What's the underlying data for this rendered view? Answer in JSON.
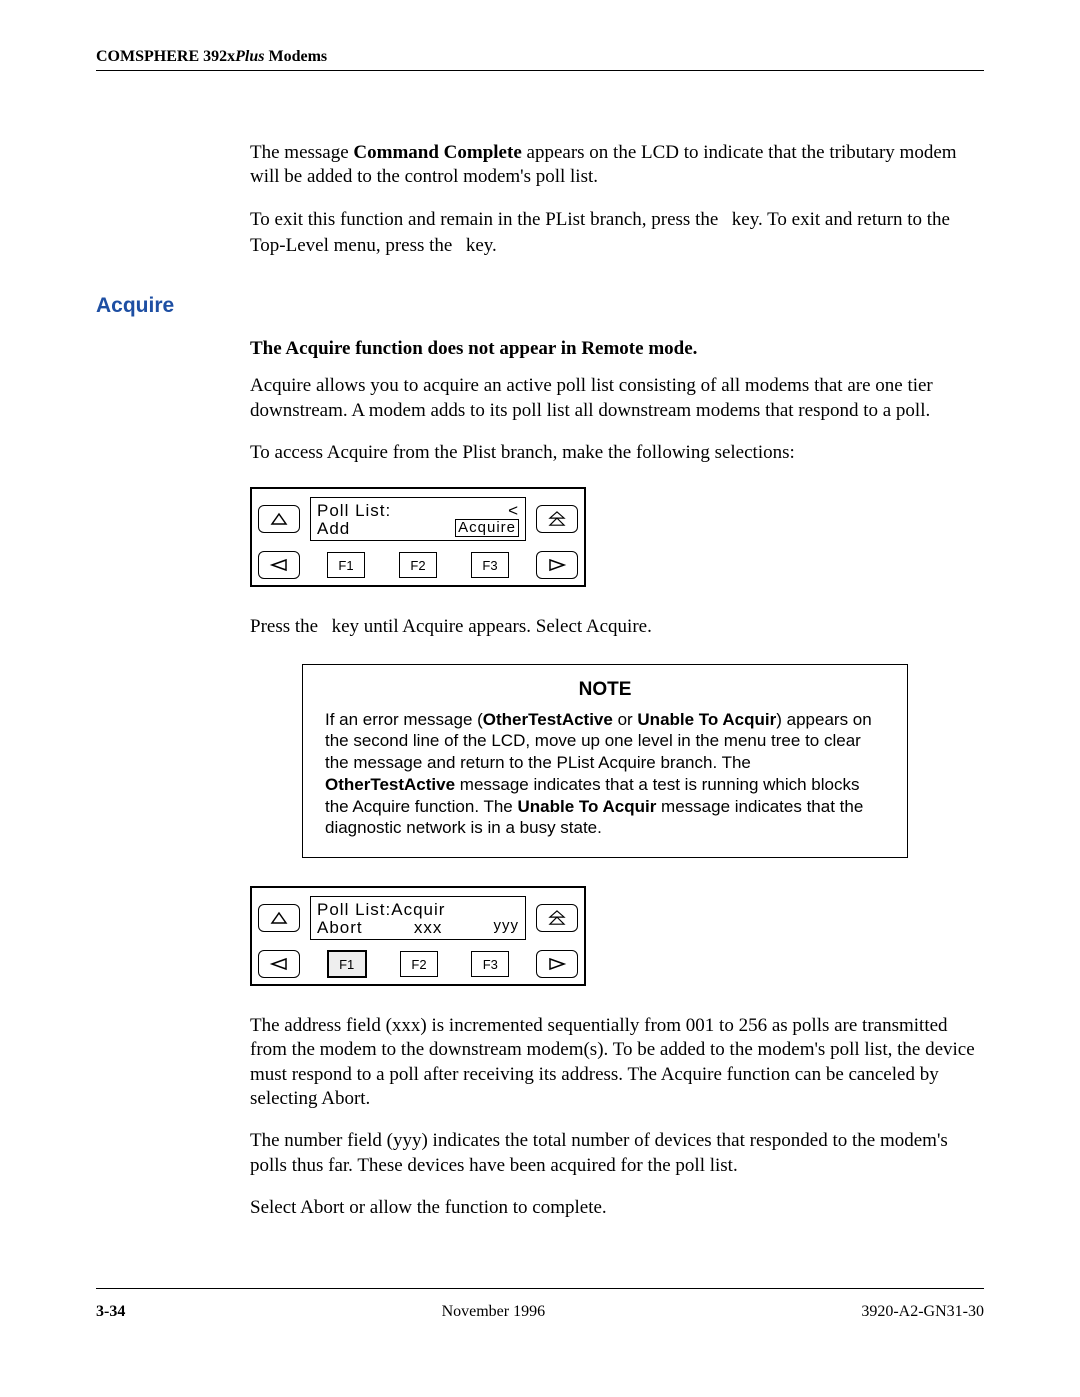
{
  "header": {
    "prefix": "COMSPHERE 392x",
    "italic": "Plus",
    "suffix": " Modems"
  },
  "paragraphs": {
    "p1_a": "The message ",
    "p1_bold": "Command Complete",
    "p1_b": " appears on the LCD to indicate that the tributary modem will be added to the control modem's poll list.",
    "p2_a": "To exit this function and remain in the PList branch, press the ",
    "p2_b": " key. To exit and return to the Top-Level menu, press the ",
    "p2_c": " key."
  },
  "section": {
    "heading": "Acquire",
    "statement": "The Acquire function does not appear in Remote mode.",
    "p1": "Acquire allows you to acquire an active poll list consisting of all modems that are one tier downstream. A modem adds to its poll list all downstream modems that respond to a poll.",
    "p2": "To access Acquire from the Plist branch, make the following selections:"
  },
  "lcd1": {
    "line1_left": "Poll  List:",
    "line1_right": "<",
    "line2_left": "Add",
    "line2_right_boxed": "Acquire",
    "f1": "F1",
    "f2": "F2",
    "f3": "F3"
  },
  "after_lcd1": {
    "a": "Press the ",
    "b": " key until Acquire appears. Select Acquire."
  },
  "note": {
    "title": "NOTE",
    "t1": "If an error message (",
    "b1": "OtherTestActive",
    "t2": " or ",
    "b2": "Unable To Acquir",
    "t3": ") appears on the second line of the LCD, move up one level in the menu tree to clear the message and return to the PList Acquire branch. The ",
    "b3": "OtherTestActive",
    "t4": " message indicates that a test is running which blocks the Acquire function. The ",
    "b4": "Unable To Acquir",
    "t5": " message indicates that the diagnostic network is in a busy state."
  },
  "lcd2": {
    "line1_left": "Poll  List:Acquir",
    "line2_left": "Abort",
    "line2_mid": "xxx",
    "line2_right": "yyy",
    "f1": "F1",
    "f2": "F2",
    "f3": "F3"
  },
  "tail": {
    "p1": "The address field (xxx) is incremented sequentially from 001 to 256 as polls are transmitted from the modem to the downstream modem(s). To be added to the modem's poll list, the device must respond to a poll after receiving its address. The Acquire function can be canceled by selecting Abort.",
    "p2": "The number field (yyy) indicates the total number of devices that responded to the modem's polls thus far. These devices have been acquired for the poll list.",
    "p3": "Select Abort or allow the function to complete."
  },
  "footer": {
    "page": "3-34",
    "center": "November 1996",
    "doc": "3920-A2-GN31-30"
  }
}
